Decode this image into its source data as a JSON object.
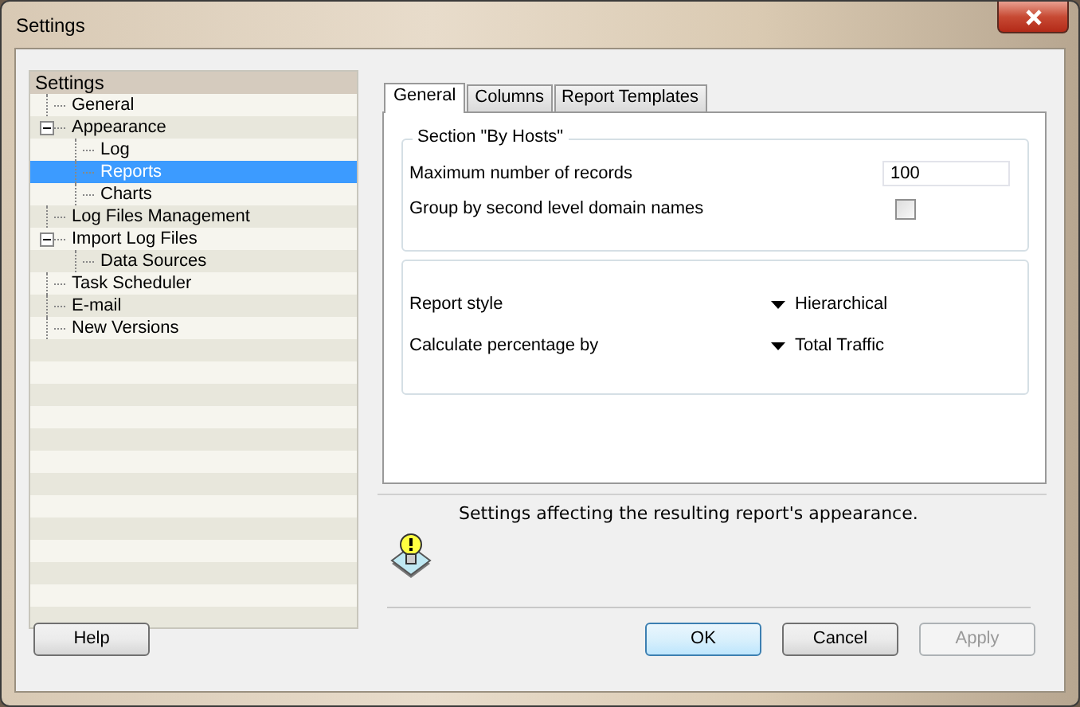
{
  "window": {
    "title": "Settings"
  },
  "tree": {
    "root": "Settings",
    "items": [
      {
        "label": "General",
        "selected": false
      },
      {
        "label": "Appearance",
        "selected": false,
        "expanded": true,
        "children": [
          {
            "label": "Log",
            "selected": false
          },
          {
            "label": "Reports",
            "selected": true
          },
          {
            "label": "Charts",
            "selected": false
          }
        ]
      },
      {
        "label": "Log Files Management",
        "selected": false
      },
      {
        "label": "Import Log Files",
        "selected": false,
        "expanded": true,
        "children": [
          {
            "label": "Data Sources",
            "selected": false
          }
        ]
      },
      {
        "label": "Task Scheduler",
        "selected": false
      },
      {
        "label": "E-mail",
        "selected": false
      },
      {
        "label": "New Versions",
        "selected": false
      }
    ]
  },
  "tabs": [
    {
      "label": "General",
      "selected": true
    },
    {
      "label": "Columns",
      "selected": false
    },
    {
      "label": "Report Templates",
      "selected": false
    }
  ],
  "section": {
    "title": "Section \"By Hosts\"",
    "max_records": {
      "label": "Maximum number of records",
      "value": "100"
    },
    "group_by": {
      "label": "Group by second level domain names",
      "checked": false
    }
  },
  "options": [
    {
      "label": "Report style",
      "value": "Hierarchical"
    },
    {
      "label": "Calculate percentage by",
      "value": "Total Traffic"
    }
  ],
  "description": "Settings affecting the resulting report's appearance.",
  "buttons": {
    "help": {
      "label": "Help",
      "disabled": false
    },
    "actions": [
      {
        "label": "OK",
        "disabled": false,
        "default": true
      },
      {
        "label": "Cancel",
        "disabled": false,
        "default": false
      },
      {
        "label": "Apply",
        "disabled": true,
        "default": false
      }
    ]
  }
}
